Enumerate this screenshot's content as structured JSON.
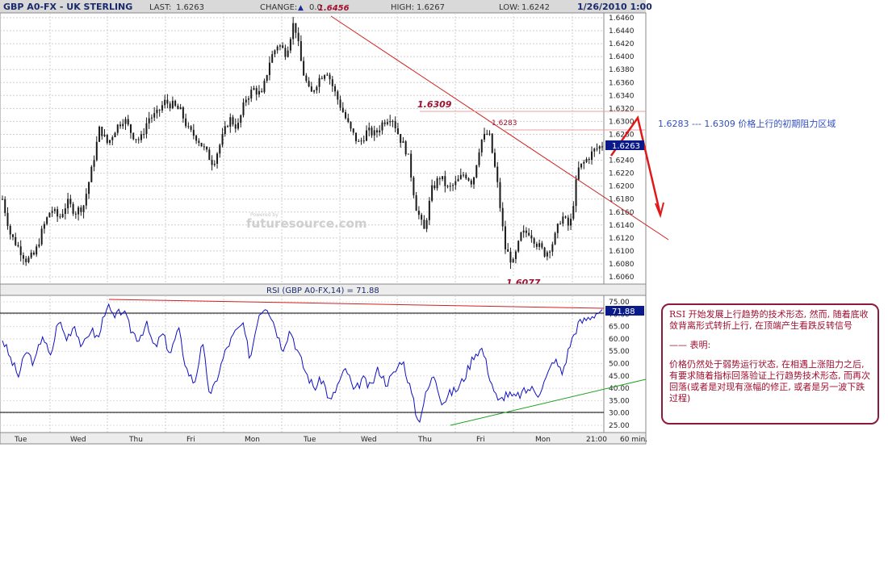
{
  "header": {
    "symbol": "GBP A0-FX - UK STERLING",
    "last_label": "LAST:",
    "last_value": "1.6263",
    "change_label": "CHANGE:",
    "change_arrow": "▲",
    "change_value": "0.0",
    "high_label": "HIGH:",
    "high_value": "1.6267",
    "low_label": "LOW:",
    "low_value": "1.6242",
    "datetime": "1/26/2010 1:00"
  },
  "watermark": {
    "small": "Powered by",
    "main": "futuresource.com"
  },
  "annotations": {
    "peak": "1.6456",
    "mid_high": "1.6309",
    "second_high": "1.6283",
    "low": "1.6077",
    "zone_note": "1.6283 --- 1.6309   价格上行的初期阻力区域"
  },
  "comment": {
    "line1_prefix": "RSI",
    "line1_rest": " 开始发展上行趋势的技术形态, 然而, 随着底收敛背离形式转折上行, 在顶端产生看跌反转信号",
    "heading": "—— 表明:",
    "body": "价格仍然处于弱势运行状态, 在相遇上涨阻力之后, 有要求随着指标回落验证上行趋势技术形态, 而再次回落(或者是对现有涨幅的修正, 或者是另一波下跌过程)"
  },
  "colors": {
    "candle": "#1a1a1a",
    "rsi_line": "#1010c0",
    "trend_red": "#d02020",
    "trend_green": "#20a020",
    "price_tag_bg": "#0a1a8a",
    "annotation_text": "#a01030",
    "zone_note_text": "#3050c0"
  },
  "chart_data": [
    {
      "type": "candlestick",
      "title": "GBP A0-FX - UK STERLING",
      "interval": "60 min.",
      "ylim": [
        1.6055,
        1.6465
      ],
      "y_ticks": [
        "1.6460",
        "1.6440",
        "1.6420",
        "1.6400",
        "1.6380",
        "1.6360",
        "1.6340",
        "1.6320",
        "1.6300",
        "1.6280",
        "1.6260",
        "1.6240",
        "1.6220",
        "1.6200",
        "1.6180",
        "1.6160",
        "1.6140",
        "1.6120",
        "1.6100",
        "1.6080",
        "1.6060"
      ],
      "x_labels": [
        "Tue",
        "Wed",
        "Thu",
        "Fri",
        "Mon",
        "Tue",
        "Wed",
        "Thu",
        "Fri",
        "Mon",
        "21:00",
        "60 min."
      ],
      "last_price_tag": "1.6263",
      "close_path": [
        1.618,
        1.6125,
        1.6105,
        1.6085,
        1.6095,
        1.6135,
        1.6165,
        1.615,
        1.6175,
        1.616,
        1.617,
        1.6225,
        1.629,
        1.6265,
        1.629,
        1.6305,
        1.628,
        1.627,
        1.6305,
        1.631,
        1.633,
        1.6325,
        1.6315,
        1.6285,
        1.6275,
        1.6255,
        1.6235,
        1.627,
        1.6305,
        1.629,
        1.6335,
        1.635,
        1.634,
        1.6395,
        1.642,
        1.6405,
        1.6456,
        1.638,
        1.634,
        1.6365,
        1.638,
        1.6345,
        1.6315,
        1.6285,
        1.6265,
        1.6285,
        1.628,
        1.63,
        1.6309,
        1.6275,
        1.625,
        1.617,
        1.613,
        1.6195,
        1.6215,
        1.6195,
        1.6205,
        1.622,
        1.6205,
        1.627,
        1.6283,
        1.621,
        1.6105,
        1.608,
        1.6125,
        1.613,
        1.611,
        1.6095,
        1.6115,
        1.6155,
        1.6135,
        1.6225,
        1.624,
        1.6255,
        1.6263
      ],
      "trendlines": [
        {
          "from": [
            1.6456
          ],
          "to_text": "descending resistance from 1.6456 peak",
          "color": "red"
        },
        {
          "level": 1.6309,
          "label": "1.6309"
        },
        {
          "level": 1.6283,
          "label": "1.6283"
        }
      ]
    },
    {
      "type": "line",
      "title": "RSI (GBP A0-FX,14) = 71.88",
      "ylim": [
        24,
        76
      ],
      "y_ticks": [
        "75.00",
        "70.00",
        "65.00",
        "60.00",
        "55.00",
        "50.00",
        "45.00",
        "40.00",
        "35.00",
        "30.00",
        "25.00"
      ],
      "reference_lines": [
        70,
        30
      ],
      "current_value": "71.88",
      "series": [
        {
          "values": [
            60,
            52,
            45,
            55,
            50,
            62,
            52,
            68,
            60,
            66,
            56,
            64,
            60,
            74,
            68,
            72,
            64,
            60,
            66,
            56,
            62,
            54,
            64,
            48,
            42,
            58,
            36,
            46,
            56,
            62,
            66,
            52,
            70,
            74,
            66,
            56,
            64,
            54,
            46,
            40,
            44,
            34,
            42,
            48,
            38,
            44,
            40,
            48,
            42,
            46,
            52,
            40,
            26,
            38,
            46,
            34,
            38,
            40,
            46,
            54,
            56,
            44,
            34,
            38,
            36,
            38,
            40,
            38,
            44,
            52,
            46,
            58,
            66,
            68,
            70,
            71.88
          ]
        }
      ]
    }
  ]
}
